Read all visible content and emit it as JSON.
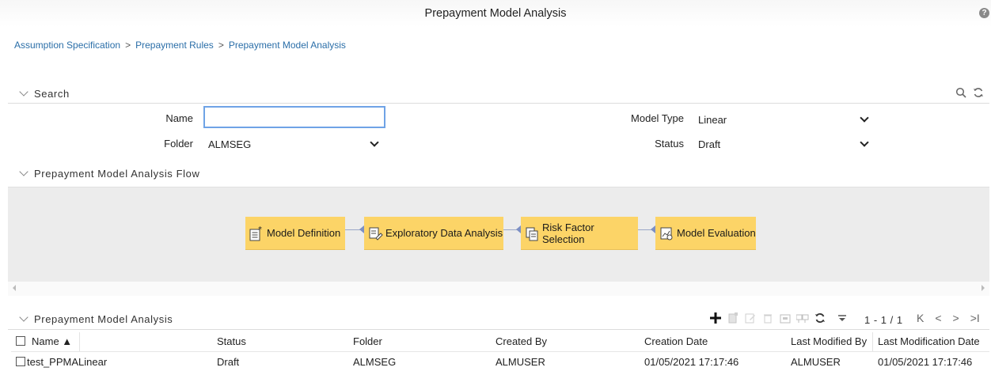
{
  "header": {
    "title": "Prepayment Model Analysis",
    "help_icon": "question-circle-icon"
  },
  "breadcrumb": {
    "items": [
      "Assumption Specification",
      "Prepayment Rules",
      "Prepayment Model Analysis"
    ],
    "separator": ">"
  },
  "search": {
    "title": "Search",
    "name_label": "Name",
    "name_value": "",
    "folder_label": "Folder",
    "folder_value": "ALMSEG",
    "model_type_label": "Model Type",
    "model_type_value": "Linear",
    "status_label": "Status",
    "status_value": "Draft",
    "icons": [
      "search-icon",
      "refresh-icon"
    ]
  },
  "flow": {
    "title": "Prepayment Model Analysis Flow",
    "nodes": [
      {
        "label": "Model Definition",
        "icon": "document-star-icon"
      },
      {
        "label": "Exploratory Data Analysis",
        "icon": "document-edit-icon"
      },
      {
        "label": "Risk Factor Selection",
        "icon": "filter-doc-icon"
      },
      {
        "label": "Model Evaluation",
        "icon": "chart-doc-icon"
      }
    ]
  },
  "grid": {
    "title": "Prepayment Model Analysis",
    "pagination": "1 - 1 / 1",
    "toolbar_icons": [
      "add-icon",
      "copy-icon",
      "edit-icon",
      "delete-icon",
      "archive-icon",
      "compare-icon",
      "refresh-icon",
      "filter-icon"
    ],
    "columns": [
      "Name ▲",
      "Status",
      "Folder",
      "Created By",
      "Creation Date",
      "Last Modified By",
      "Last Modification Date"
    ],
    "rows": [
      [
        "test_PPMALinear",
        "Draft",
        "ALMSEG",
        "ALMUSER",
        "01/05/2021 17:17:46",
        "ALMUSER",
        "01/05/2021 17:17:46"
      ]
    ]
  },
  "colors": {
    "link": "#2a6ea8",
    "flow_node": "#fcd467",
    "focus_border": "#6fa3e6"
  }
}
